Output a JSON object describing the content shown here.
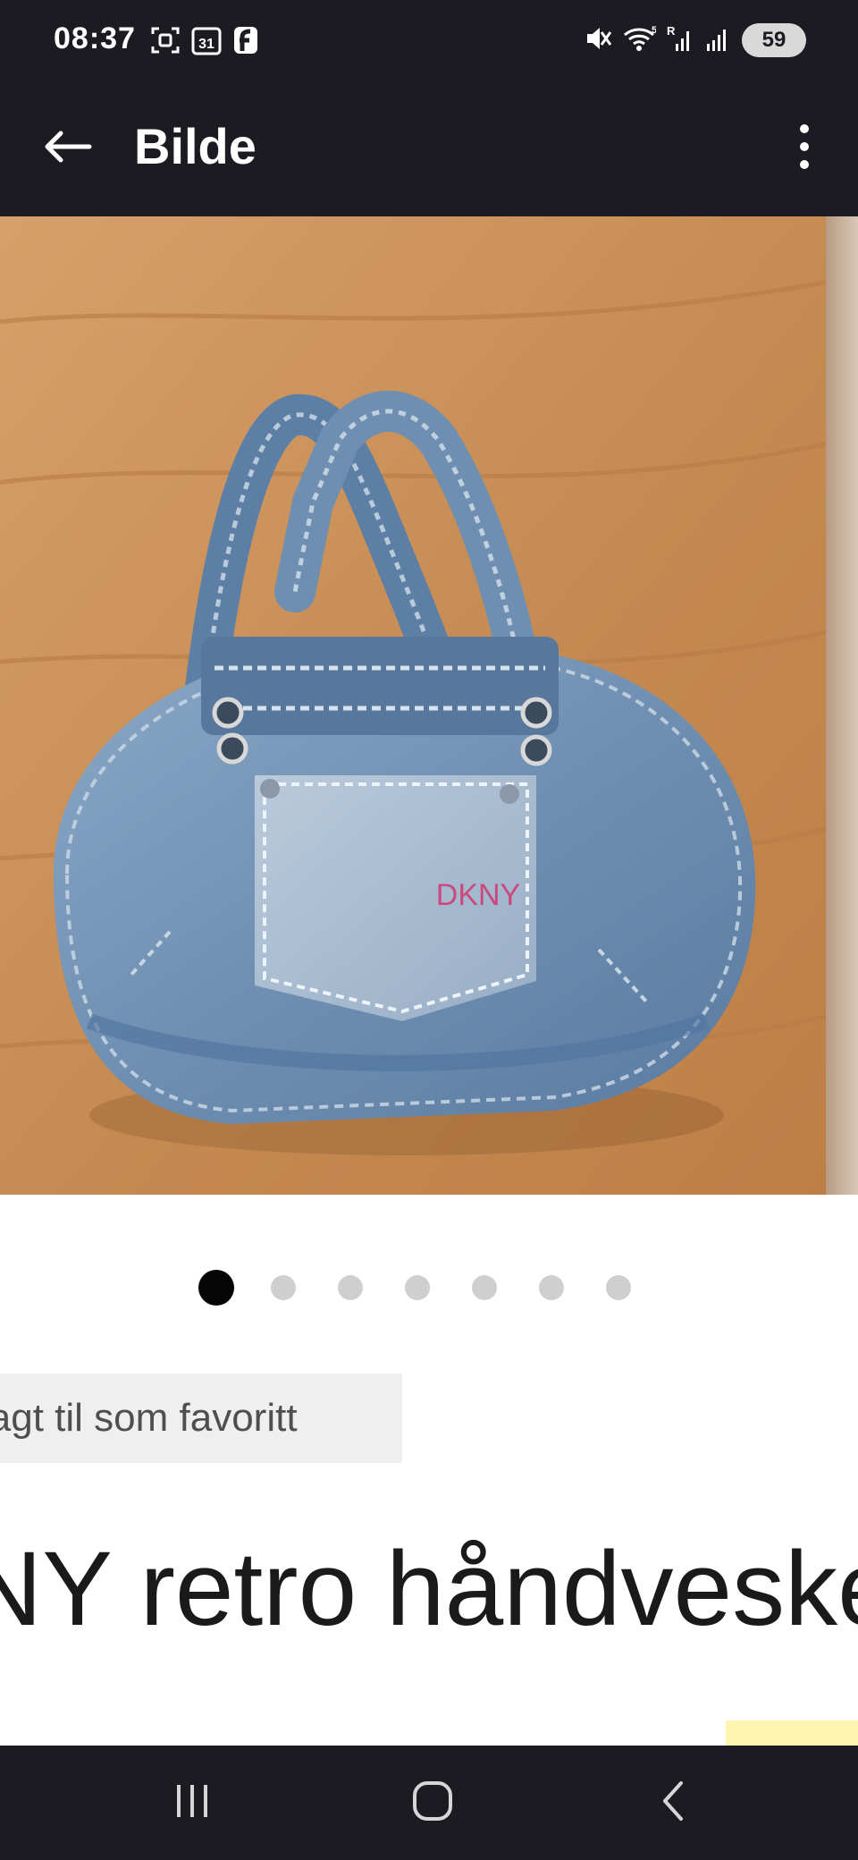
{
  "status_bar": {
    "time": "08:37",
    "battery_level": "59",
    "calendar_day": "31",
    "left_icons": [
      "screenshot-icon",
      "calendar-icon",
      "app-notification-icon"
    ],
    "right_icons": [
      "mute-icon",
      "wifi-icon",
      "signal-r-icon",
      "signal-icon",
      "battery-icon"
    ],
    "wifi_label": "5",
    "roaming_label": "R"
  },
  "app_bar": {
    "title": "Bilde",
    "back_icon": "back-arrow-icon",
    "menu_icon": "more-vertical-icon"
  },
  "gallery": {
    "image_count": 7,
    "active_index": 0,
    "pocket_brand_text": "DKNY"
  },
  "listing": {
    "favorite_label": "lagt til som favoritt",
    "title": "NY retro håndveske"
  },
  "nav_bar": {
    "buttons": [
      "recents-icon",
      "home-icon",
      "back-icon"
    ]
  },
  "colors": {
    "chrome": "#1b1b21",
    "floor": "#c98f55",
    "denim": "#6f8fb2",
    "active_dot": "#050505",
    "inactive_dot": "#cfcfcf",
    "chip_bg": "#efefef"
  }
}
